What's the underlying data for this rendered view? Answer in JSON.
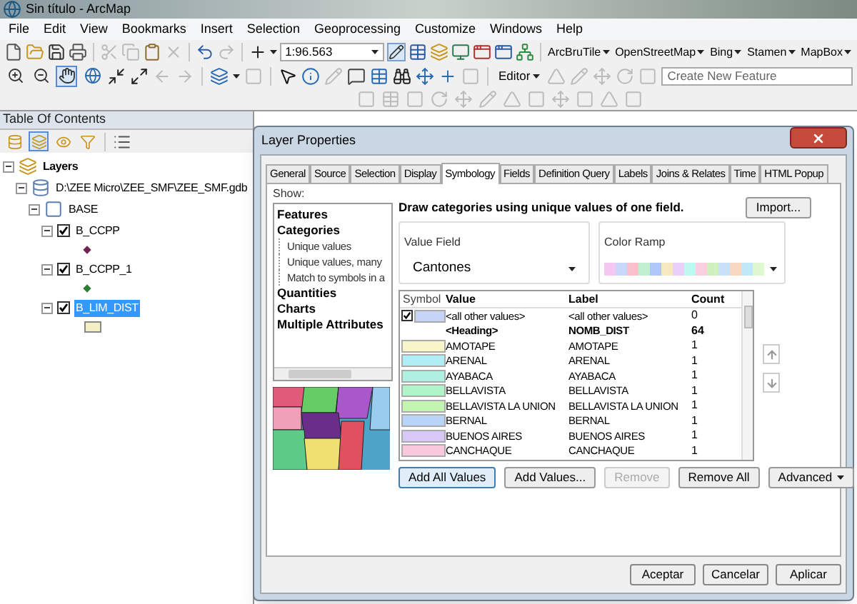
{
  "window": {
    "title": "Sin título - ArcMap"
  },
  "menu": [
    "File",
    "Edit",
    "View",
    "Bookmarks",
    "Insert",
    "Selection",
    "Geoprocessing",
    "Customize",
    "Windows",
    "Help"
  ],
  "scale": {
    "value": "1:96.563"
  },
  "tile_menus": [
    "ArcBruTile",
    "OpenStreetMap",
    "Bing",
    "Stamen",
    "MapBox"
  ],
  "tools": [
    {
      "kind": "zoom-in",
      "selected": false
    },
    {
      "kind": "zoom-out",
      "selected": false
    },
    {
      "kind": "pan",
      "selected": true
    },
    {
      "kind": "globe",
      "selected": false
    }
  ],
  "editor": {
    "label": "Editor",
    "placeholder": "Create New Feature"
  },
  "toc": {
    "title": "Table Of Contents",
    "views": [
      {
        "kind": "source",
        "selected": false
      },
      {
        "kind": "drawing-order",
        "selected": true
      },
      {
        "kind": "visibility",
        "selected": false
      },
      {
        "kind": "selection",
        "selected": false
      }
    ],
    "tree": [
      {
        "kind": "dataframe",
        "label": "Layers",
        "expanded": true,
        "children": [
          {
            "kind": "geodatabase",
            "label": "D:\\ZEE Micro\\ZEE_SMF\\ZEE_SMF.gdb",
            "expanded": true,
            "children": [
              {
                "kind": "dataset",
                "label": "BASE",
                "expanded": true,
                "children": [
                  {
                    "kind": "layer",
                    "label": "B_CCPP",
                    "expanded": true,
                    "checked": true,
                    "selected": false,
                    "symbol": {
                      "kind": "point",
                      "color": "#6b2550"
                    }
                  },
                  {
                    "kind": "layer",
                    "label": "B_CCPP_1",
                    "expanded": true,
                    "checked": true,
                    "selected": false,
                    "symbol": {
                      "kind": "point",
                      "color": "#2e7d32"
                    }
                  },
                  {
                    "kind": "layer",
                    "label": "B_LIM_DIST",
                    "expanded": true,
                    "checked": true,
                    "selected": true,
                    "symbol": {
                      "kind": "polygon",
                      "color": "#f5efc4"
                    }
                  }
                ]
              }
            ]
          }
        ]
      }
    ]
  },
  "dialog": {
    "title": "Layer Properties",
    "tabs": [
      {
        "label": "General",
        "selected": false
      },
      {
        "label": "Source",
        "selected": false
      },
      {
        "label": "Selection",
        "selected": false
      },
      {
        "label": "Display",
        "selected": false
      },
      {
        "label": "Symbology",
        "selected": true
      },
      {
        "label": "Fields",
        "selected": false
      },
      {
        "label": "Definition Query",
        "selected": false
      },
      {
        "label": "Labels",
        "selected": false
      },
      {
        "label": "Joins & Relates",
        "selected": false
      },
      {
        "label": "Time",
        "selected": false
      },
      {
        "label": "HTML Popup",
        "selected": false
      }
    ],
    "show": {
      "label": "Show:",
      "items": [
        {
          "label": "Features"
        },
        {
          "label": "Categories",
          "children": [
            {
              "label": "Unique values"
            },
            {
              "label": "Unique values, many"
            },
            {
              "label": "Match to symbols in a"
            }
          ]
        },
        {
          "label": "Quantities"
        },
        {
          "label": "Charts"
        },
        {
          "label": "Multiple Attributes"
        }
      ]
    },
    "description": "Draw categories using unique values of one field.",
    "import_button": "Import...",
    "value_field": {
      "label": "Value Field",
      "value": "Cantones"
    },
    "color_ramp": {
      "label": "Color Ramp"
    },
    "table": {
      "columns": [
        "Symbol",
        "Value",
        "Label",
        "Count"
      ],
      "rows": [
        {
          "kind": "other",
          "checked": true,
          "color": "#c8d4f5",
          "value": "<all other values>",
          "label": "<all other values>",
          "count": "0"
        },
        {
          "kind": "heading",
          "value": "<Heading>",
          "label": "NOMB_DIST",
          "count": "64"
        },
        {
          "kind": "value",
          "color": "#f8f5c8",
          "value": "AMOTAPE",
          "label": "AMOTAPE",
          "count": "1"
        },
        {
          "kind": "value",
          "color": "#b0eef5",
          "value": "ARENAL",
          "label": "ARENAL",
          "count": "1"
        },
        {
          "kind": "value",
          "color": "#b0f0e0",
          "value": "AYABACA",
          "label": "AYABACA",
          "count": "1"
        },
        {
          "kind": "value",
          "color": "#b0f5c8",
          "value": "BELLAVISTA",
          "label": "BELLAVISTA",
          "count": "1"
        },
        {
          "kind": "value",
          "color": "#c4f5b0",
          "value": "BELLAVISTA LA UNION",
          "label": "BELLAVISTA LA UNION",
          "count": "1"
        },
        {
          "kind": "value",
          "color": "#b8d4f8",
          "value": "BERNAL",
          "label": "BERNAL",
          "count": "1"
        },
        {
          "kind": "value",
          "color": "#d8c8f8",
          "value": "BUENOS AIRES",
          "label": "BUENOS AIRES",
          "count": "1"
        },
        {
          "kind": "value",
          "color": "#f8c8dc",
          "value": "CANCHAQUE",
          "label": "CANCHAQUE",
          "count": "1"
        }
      ]
    },
    "actions": [
      {
        "label": "Add All Values",
        "disabled": false,
        "focused": true
      },
      {
        "label": "Add Values...",
        "disabled": false,
        "focused": false
      },
      {
        "label": "Remove",
        "disabled": true,
        "focused": false
      },
      {
        "label": "Remove All",
        "disabled": false,
        "focused": false
      }
    ],
    "advanced": "Advanced",
    "footer": [
      "Aceptar",
      "Cancelar",
      "Aplicar"
    ]
  }
}
